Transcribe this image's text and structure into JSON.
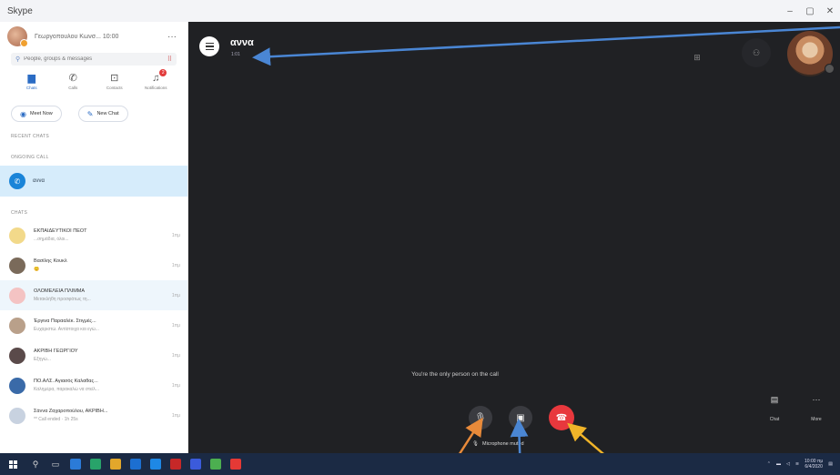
{
  "window": {
    "app_name": "Skype",
    "controls": [
      "–",
      "▢",
      "✕"
    ]
  },
  "sidebar": {
    "profile_name": "Γεωργοπουλου Κωνσ... 10:00",
    "more_glyph": "···",
    "search_placeholder": "People, groups & messages",
    "tabs": [
      {
        "label": "Chats",
        "icon": "chat-icon"
      },
      {
        "label": "Calls",
        "icon": "phone-icon"
      },
      {
        "label": "Contacts",
        "icon": "contacts-icon"
      },
      {
        "label": "Notifications",
        "icon": "bell-icon",
        "badge": "2"
      }
    ],
    "meet_now_label": "Meet Now",
    "new_chat_label": "New Chat",
    "recent_chats_label": "RECENT CHATS",
    "ongoing_calls_label": "ONGOING CALL",
    "ongoing_call_name": "αννα",
    "chats_label": "CHATS",
    "chats": [
      {
        "title": "ΕΚΠΑΙΔΕΥΤΙΚΟΙ ΠΕΟΤ",
        "sub": "...σημάδια, όλοι...",
        "time": "1πμ",
        "avatar": "#f2d98a"
      },
      {
        "title": "Βασίλης Κουκλ",
        "sub": "😊",
        "time": "1πμ",
        "avatar": "#7a6a5a"
      },
      {
        "title": "ΟΛΟΜΕΛΕΙΑ ΠΛΙΜΜΑ",
        "sub": "Μετακλήθη προσφάτως τη...",
        "time": "1πμ",
        "avatar": "#f4c3c3"
      },
      {
        "title": "Έργινα Παρααλέκ. Στιγμές...",
        "sub": "Ευχαριστώ. Αντίστοιχα και εγώ...",
        "time": "1πμ",
        "avatar": "#b9a08a"
      },
      {
        "title": "ΑΚΡΙΒΗ ΓΕΩΡΓΙΟΥ",
        "sub": "Εξηγώ...",
        "time": "1πμ",
        "avatar": "#5a4a4a"
      },
      {
        "title": "ΠΟ.ΑΛΣ. Αγιασός Καλαθας...",
        "sub": "Καλημέρα, παρακαλώ να στείλ...",
        "time": "1πμ",
        "avatar": "#3a6aa8"
      },
      {
        "title": "Σάννα Ζαχαροπούλου, ΑΚΡΙΒΗ...",
        "sub": "** Call ended · 1h 25s",
        "time": "1πμ",
        "avatar": "#c8d2e0"
      }
    ]
  },
  "call": {
    "title": "αννα",
    "timer": "1:01",
    "only_person": "You're the only person on the call",
    "mic_muted": "Microphone muted",
    "chat_label": "Chat",
    "more_label": "More"
  },
  "taskbar": {
    "clock_time": "10:00 πμ",
    "clock_date": "6/4/2020",
    "apps": [
      "#2b7bd8",
      "#28a36a",
      "#e2a72b",
      "#1c6fd1",
      "#1e88e5",
      "#c62828",
      "#3b5bdb",
      "#4caf50",
      "#e53935"
    ]
  },
  "colors": {
    "accent": "#2b6cc4",
    "hangup": "#e8383d",
    "arrow_blue": "#4a86d4",
    "arrow_orange": "#e88a3a",
    "arrow_yellow": "#f0b429"
  }
}
